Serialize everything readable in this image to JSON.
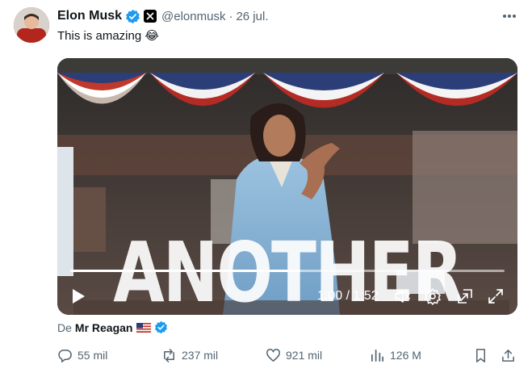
{
  "tweet": {
    "author_name": "Elon Musk",
    "author_handle": "@elonmusk",
    "separator": "·",
    "date": "26 jul.",
    "text": "This is amazing",
    "emoji": "😂",
    "media": {
      "overlay_text": "ANOTHER",
      "time_display": "1:00 / 1:52",
      "progress_fraction": 0.53
    },
    "attribution": {
      "prefix": "De",
      "source": "Mr Reagan"
    },
    "stats": {
      "replies": "55 mil",
      "reposts": "237 mil",
      "likes": "921 mil",
      "views": "126 M"
    },
    "colors": {
      "verified_blue": "#1d9bf0",
      "secondary_text": "#536471",
      "primary_text": "#0f1419"
    }
  }
}
